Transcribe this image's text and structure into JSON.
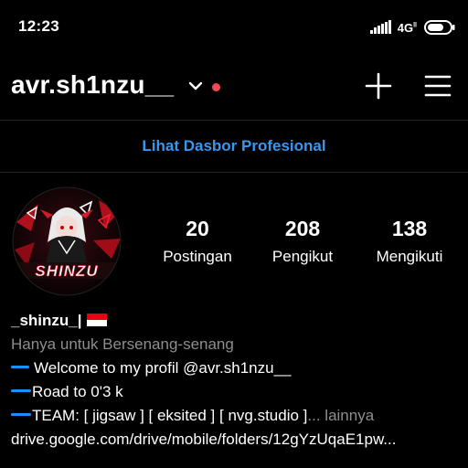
{
  "status_bar": {
    "time": "12:23",
    "network": "4G",
    "network_sub": "ll",
    "icons": [
      "signal-icon",
      "battery-icon"
    ]
  },
  "header": {
    "username": "avr.sh1nzu__",
    "icons": [
      "chevron-down-icon",
      "notification-dot",
      "plus-icon",
      "hamburger-menu-icon"
    ]
  },
  "dashboard": {
    "label": "Lihat Dasbor Profesional"
  },
  "avatar": {
    "wordmark": "SHINZU"
  },
  "stats": {
    "posts": {
      "count": "20",
      "label": "Postingan"
    },
    "followers": {
      "count": "208",
      "label": "Pengikut"
    },
    "following": {
      "count": "138",
      "label": "Mengikuti"
    }
  },
  "bio": {
    "display_name": "_shinzu_|",
    "category": "Hanya untuk Bersenang-senang",
    "line1": "Welcome to my profil @avr.sh1nzu__",
    "line2": "Road to 0'3 k",
    "line3": "TEAM: [ jigsaw ] [ eksited ] [ nvg.studio ]",
    "more": "... lainnya",
    "link": "drive.google.com/drive/mobile/folders/12gYzUqaE1pw..."
  },
  "colors": {
    "background": "#000000",
    "link_blue": "#3897f0",
    "accent_bar": "#1a8fff",
    "notification_red": "#ed4956",
    "secondary_text": "#8e8e8e",
    "divider": "#262626"
  }
}
